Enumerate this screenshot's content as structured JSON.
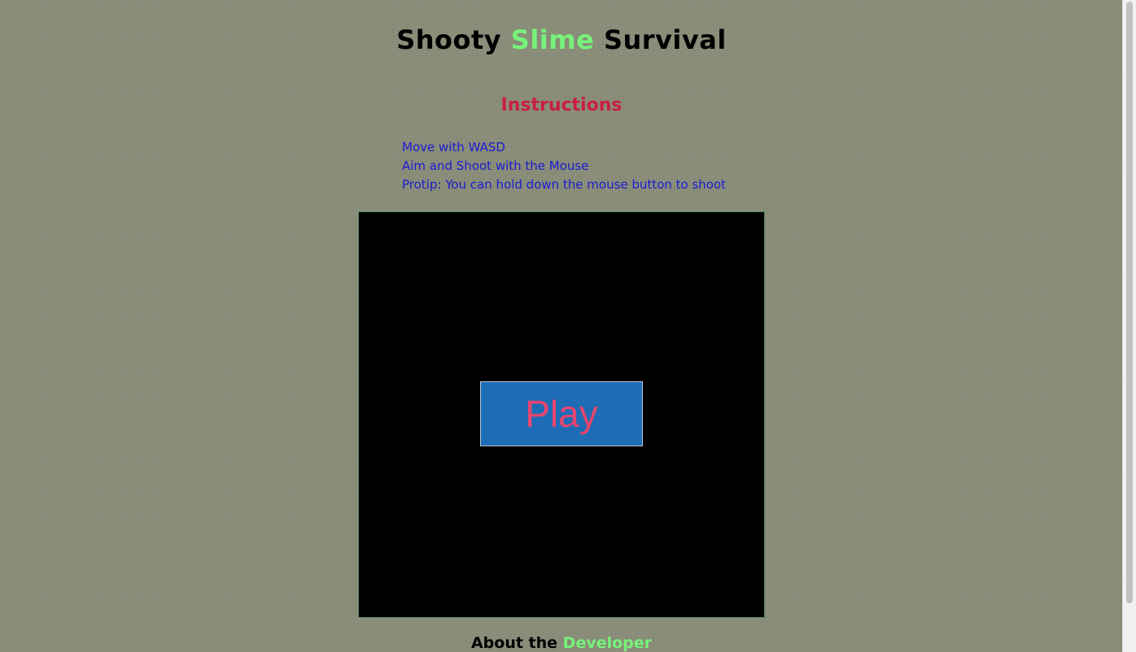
{
  "header": {
    "title_part1": "Shooty",
    "title_part2": "Slime",
    "title_part3": "Survival"
  },
  "instructions": {
    "heading": "Instructions",
    "lines": [
      "Move with WASD",
      "Aim and Shoot with the Mouse",
      "Protip: You can hold down the mouse button to shoot"
    ]
  },
  "game": {
    "play_label": "Play"
  },
  "footer": {
    "about_part1": "About the",
    "about_part2": "Developer"
  },
  "colors": {
    "background": "#8a8d78",
    "slime_green": "#77f27a",
    "heading_red": "#c81e45",
    "instruction_blue": "#1b1bd1",
    "play_bg": "#1d6cb5",
    "play_text": "#e8456e"
  }
}
